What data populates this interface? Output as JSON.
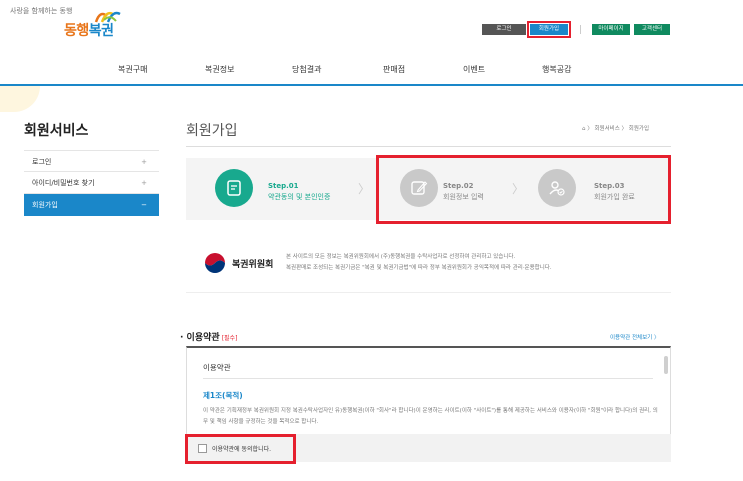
{
  "header": {
    "slogan": "사랑을 함께하는 동행",
    "logo_part1": "동행",
    "logo_part2": "복권",
    "login": "로그인",
    "join": "회원가입",
    "mypage": "마이페이지",
    "customer_center": "고객센터"
  },
  "nav": [
    "복권구매",
    "복권정보",
    "당첨결과",
    "판매점",
    "이벤트",
    "행복공감"
  ],
  "sidebar": {
    "title": "회원서비스",
    "items": [
      {
        "label": "로그인",
        "sign": "+"
      },
      {
        "label": "아이디/비밀번호 찾기",
        "sign": "+"
      },
      {
        "label": "회원가입",
        "sign": "−"
      }
    ]
  },
  "page": {
    "title": "회원가입",
    "breadcrumb": "⌂ 〉 회원서비스 〉 회원가입"
  },
  "steps": [
    {
      "no": "Step.01",
      "label": "약관동의 및 본인인증"
    },
    {
      "no": "Step.02",
      "label": "회원정보 입력"
    },
    {
      "no": "Step.03",
      "label": "회원가입 완료"
    }
  ],
  "notice": {
    "org": "복권위원회",
    "line1": "본 사이트의 모든 정보는 복권위원회에서 (주)동행복권을 수탁사업자로 선정하여 관리하고 있습니다.",
    "line2": "복권판매로 조성되는 복권기금은 \"복권 및 복권기금법\"에 따라 정부 복권위원회가 공익목적에 따라 관리·운용합니다."
  },
  "terms": {
    "heading": "· 이용약관",
    "required": "[필수]",
    "view_all": "이용약관 전체보기 〉",
    "box_title": "이용약관",
    "article_title": "제1조(목적)",
    "article_body": "이 약관은 기획재정부 복권위원회 지정 복권수탁사업자인 유)동행복권(이하 \"회사\"라 합니다)이 운영하는 사이트(이하 \"사이트\")를 통해 제공하는 서비스와 이용자(이하 \"회원\"이라 합니다)의 권리, 의무 및 책임 사항을 규정하는 것을 목적으로 합니다.",
    "agree_label": "이용약관에 동의합니다."
  },
  "colors": {
    "accent_blue": "#1a87c9",
    "step_green": "#18a98e",
    "highlight_red": "#e5202e"
  }
}
